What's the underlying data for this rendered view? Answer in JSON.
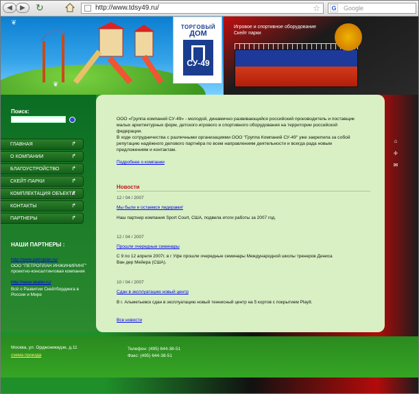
{
  "browser": {
    "url": "http://www.tdsy49.ru/",
    "search_placeholder": "Google",
    "search_engine_letter": "G"
  },
  "header": {
    "logo_line1": "ТОРГОВЫЙ",
    "logo_line2": "ДОМ",
    "logo_line3": "СУ-49",
    "tagline1": "Игровое и спортивное оборудование",
    "tagline2": "Скейт парки"
  },
  "sidebar": {
    "search_label": "Поиск:",
    "menu": [
      {
        "label": "ГЛАВНАЯ"
      },
      {
        "label": "О КОМПАНИИ"
      },
      {
        "label": "БЛАГОУСТРОЙСТВО"
      },
      {
        "label": "СКЕЙТ-ПАРКИ"
      },
      {
        "label": "КОМПЛЕКТАЦИЯ ОБЪЕКТА"
      },
      {
        "label": "КОНТАКТЫ"
      },
      {
        "label": "ПАРТНЕРЫ"
      }
    ],
    "partners_header": "НАШИ ПАРТНЕРЫ :",
    "partners": [
      {
        "link": "http://www.petroplan.ru/",
        "text1": "ООО \"ПЕТРОПЛАН ИНЖИНИРИНГ\"",
        "text2": "проектно-консалтинговая компания"
      },
      {
        "link": "http://www.skater.ru/",
        "text1": "Всё о Развитии Скейтбординга в",
        "text2": "России и Мире"
      }
    ]
  },
  "main": {
    "intro": [
      "ООО «Группа компаний СУ-49» - молодой, динамично развивающийся российский производитель и поставщик",
      "малых архитектурных форм, детского игрового и спортивного оборудования на территории российской",
      "федерации.",
      "В ходе сотрудничества с различными организациями ООО \"Группа Компаний СУ-49\" уже закрепила за собой",
      "репутацию надёжного делового партнёра по всем направлениям деятельности и всегда рада новым",
      "предложениям и контактам."
    ],
    "about_link": "Подробнее о компании",
    "news_header": "Новости",
    "news": [
      {
        "date": "12 / 04 / 2007",
        "title": "Мы были и остаемся лидерами!",
        "text": [
          "Наш партнер компания Sport Court, США, подвела итоги работы за 2007 год."
        ]
      },
      {
        "date": "12 / 04 / 2007",
        "title": "Прошли очередные семинары",
        "text": [
          "С 9 по 12 апреля 2007г. в г Уфе прошли очередные семинары Международной школы тренеров Дениса",
          "Ван дер Мейера (США)."
        ]
      },
      {
        "date": "10 / 04 / 2007",
        "title": "Сдан в эксплуатацию новый центр",
        "text": [
          "В г. Альметьевск сдан в эксплуатацию новый теннисный центр на 5 кортов с покрытием PlayIt."
        ]
      }
    ],
    "all_news": "Все новости"
  },
  "footer": {
    "address": "Москва, ул. Орджоникидзе, д.11",
    "map_link": "схема проезда",
    "phone": "Телефон: (495) 644-38-51",
    "fax": "Факс: (495) 644-38-51"
  },
  "colors": {
    "news_red": "#c01818",
    "menu_green": "#145f19",
    "content_bg": "#d8f0c3"
  }
}
